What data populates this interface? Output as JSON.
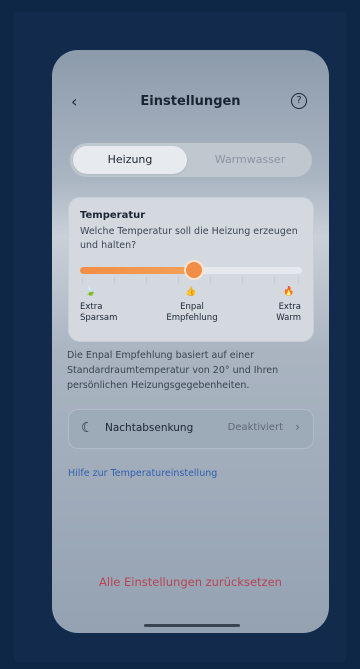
{
  "header": {
    "back_icon": "chevron-left-icon",
    "back_glyph": "‹",
    "title": "Einstellungen",
    "help_icon": "question-circle-icon",
    "help_glyph": "?"
  },
  "segmented": {
    "active": "Heizung",
    "inactive": "Warmwasser"
  },
  "temperature_card": {
    "title": "Temperatur",
    "subtitle": "Welche Temperatur soll die Heizung erzeugen und halten?",
    "slider_level_percent": 50,
    "labels": {
      "left_line1": "Extra",
      "left_line2": "Sparsam",
      "mid_line1": "Enpal",
      "mid_line2": "Empfehlung",
      "right_line1": "Extra",
      "right_line2": "Warm"
    },
    "icons": {
      "left": "leaf-icon",
      "left_glyph": "🍃",
      "mid": "thumbs-up-icon",
      "mid_glyph": "👍",
      "right": "flame-icon",
      "right_glyph": "🔥"
    }
  },
  "info_text": "Die Enpal Empfehlung basiert auf einer Standardraumtemperatur von 20° und Ihren persönlichen Heizungsgegebenheiten.",
  "night_setback": {
    "icon": "moon-icon",
    "icon_glyph": "☾",
    "label": "Nachtabsenkung",
    "value": "Deaktiviert",
    "chevron_icon": "chevron-right-icon",
    "chevron_glyph": "›"
  },
  "help_link": "Hilfe zur Temperatureinstellung",
  "reset_button": "Alle Einstellungen zurücksetzen",
  "colors": {
    "accent": "#F28D46",
    "link": "#2F5FB0",
    "reset": "#B74455"
  }
}
